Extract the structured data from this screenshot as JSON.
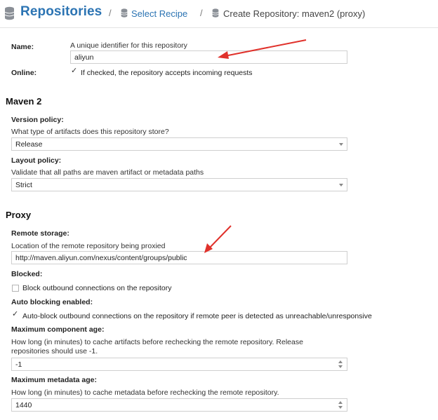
{
  "header": {
    "title": "Repositories",
    "separator": "/",
    "crumbs": [
      {
        "label": "Select Recipe"
      },
      {
        "label": "Create Repository: maven2 (proxy)"
      }
    ]
  },
  "form": {
    "name": {
      "label": "Name:",
      "help": "A unique identifier for this repository",
      "value": "aliyun"
    },
    "online": {
      "label": "Online:",
      "checked": true,
      "text": "If checked, the repository accepts incoming requests"
    },
    "maven_section": "Maven 2",
    "version_policy": {
      "label": "Version policy:",
      "help": "What type of artifacts does this repository store?",
      "value": "Release"
    },
    "layout_policy": {
      "label": "Layout policy:",
      "help": "Validate that all paths are maven artifact or metadata paths",
      "value": "Strict"
    },
    "proxy_section": "Proxy",
    "remote_storage": {
      "label": "Remote storage:",
      "help": "Location of the remote repository being proxied",
      "value": "http://maven.aliyun.com/nexus/content/groups/public"
    },
    "blocked": {
      "label": "Blocked:",
      "checked": false,
      "text": "Block outbound connections on the repository"
    },
    "auto_blocking": {
      "label": "Auto blocking enabled:",
      "checked": true,
      "text": "Auto-block outbound connections on the repository if remote peer is detected as unreachable/unresponsive"
    },
    "max_component_age": {
      "label": "Maximum component age:",
      "help_line1": "How long (in minutes) to cache artifacts before rechecking the remote repository. Release",
      "help_line2": "repositories should use -1.",
      "value": "-1"
    },
    "max_metadata_age": {
      "label": "Maximum metadata age:",
      "help": "How long (in minutes) to cache metadata before rechecking the remote repository.",
      "value": "1440"
    }
  },
  "colors": {
    "accent": "#2c74b3",
    "annotation_arrow": "#e0312b"
  },
  "icons": [
    "database-icon",
    "checkmark-icon",
    "dropdown-caret-icon",
    "spinner-icon",
    "annotation-arrow"
  ]
}
